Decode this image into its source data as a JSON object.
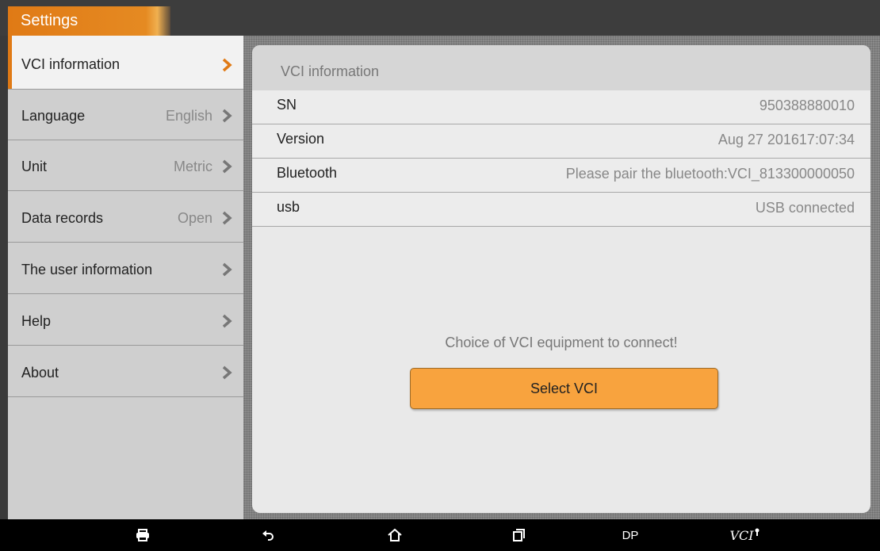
{
  "header": {
    "title": "Settings"
  },
  "sidebar": {
    "items": [
      {
        "label": "VCI information",
        "value": ""
      },
      {
        "label": "Language",
        "value": "English"
      },
      {
        "label": "Unit",
        "value": "Metric"
      },
      {
        "label": "Data records",
        "value": "Open"
      },
      {
        "label": "The user information",
        "value": ""
      },
      {
        "label": "Help",
        "value": ""
      },
      {
        "label": "About",
        "value": ""
      }
    ]
  },
  "panel": {
    "title": "VCI information",
    "rows": [
      {
        "label": "SN",
        "value": "950388880010"
      },
      {
        "label": "Version",
        "value": "Aug 27 201617:07:34"
      },
      {
        "label": "Bluetooth",
        "value": "Please pair the bluetooth:VCI_813300000050"
      },
      {
        "label": "usb",
        "value": "USB connected"
      }
    ],
    "prompt": "Choice of VCI equipment to connect!",
    "select_button": "Select VCI"
  },
  "navbar": {
    "icons": [
      "print-icon",
      "back-icon",
      "home-icon",
      "recent-apps-icon"
    ],
    "dp_label": "DP",
    "vci_label": "VCI"
  },
  "colors": {
    "accent": "#e07a15",
    "button": "#f8a33e"
  }
}
